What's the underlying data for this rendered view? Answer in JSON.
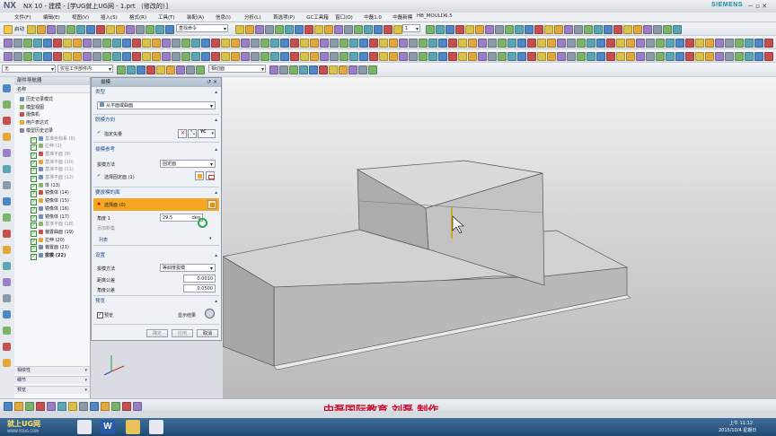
{
  "window": {
    "logo": "NX",
    "title": "NX 10 - 建模 - [学UG就上UG网 - 1.prt （修改的）]",
    "brand": "SIEMENS",
    "controls": "－ ▫ ✕"
  },
  "menubar": {
    "items": [
      "文件(F)",
      "编辑(E)",
      "视图(V)",
      "插入(S)",
      "格式(R)",
      "工具(T)",
      "装配(A)",
      "信息(I)",
      "分析(L)",
      "首选项(P)",
      "GC工具箱",
      "窗口(O)",
      "中磊1.0",
      "中磊新模",
      "HB_MOULD6.5"
    ]
  },
  "toolbar1": {
    "start_label": "启动",
    "command_finder_placeholder": "查找命令",
    "layer_value": "1"
  },
  "toolbar3": {
    "filter_value": "无",
    "scope_value": "仅在工作部件内",
    "snap_value": "相切面"
  },
  "navigator": {
    "title": "部件导航器",
    "column_name": "名称",
    "items": [
      {
        "label": "历史记录模式",
        "style": "normal"
      },
      {
        "label": "模型视图",
        "style": "normal"
      },
      {
        "label": "摄像机",
        "style": "normal"
      },
      {
        "label": "用户表达式",
        "style": "normal"
      },
      {
        "label": "模型历史记录",
        "style": "normal"
      },
      {
        "label": "基准坐标系 (0)",
        "style": "dim"
      },
      {
        "label": "拉伸 (1)",
        "style": "dim"
      },
      {
        "label": "基准平面 (9)",
        "style": "dim"
      },
      {
        "label": "基准平面 (10)",
        "style": "dim"
      },
      {
        "label": "基准平面 (11)",
        "style": "dim"
      },
      {
        "label": "基准平面 (12)",
        "style": "dim"
      },
      {
        "label": "体 (13)",
        "style": "normal"
      },
      {
        "label": "镜像体 (14)",
        "style": "normal"
      },
      {
        "label": "镜像体 (15)",
        "style": "normal"
      },
      {
        "label": "镜像体 (16)",
        "style": "normal"
      },
      {
        "label": "镜像体 (17)",
        "style": "normal"
      },
      {
        "label": "基准平面 (18)",
        "style": "dim"
      },
      {
        "label": "偏置曲面 (19)",
        "style": "normal"
      },
      {
        "label": "拉伸 (20)",
        "style": "normal"
      },
      {
        "label": "偏置面 (21)",
        "style": "normal"
      },
      {
        "label": "拔模 (22)",
        "style": "bold"
      }
    ],
    "sections": [
      "相依性",
      "细节",
      "预览"
    ]
  },
  "dialog": {
    "title": "拔模",
    "type_section": "类型",
    "type_value": "从平面或曲面",
    "direction_section": "脱模方向",
    "direction_label": "指定矢量",
    "vector_tag": "YC",
    "reference_section": "拔模参考",
    "draft_method_label": "拔模方法",
    "draft_method_value": "固定面",
    "select_fixed_face": "选择固定面 (1)",
    "faces_section": "要拔模的面",
    "select_face": "选择面 (0)",
    "angle_label": "角度 1",
    "angle_value": "29.5",
    "angle_unit": "deg",
    "add_set": "添加新集",
    "list_label": "列表",
    "settings_section": "设置",
    "settings_method_label": "拔模方法",
    "settings_method_value": "等斜度拔模",
    "distance_tol_label": "距离公差",
    "distance_tol_value": "0.0010",
    "angle_tol_label": "角度公差",
    "angle_tol_value": "0.0500",
    "preview_section": "预览",
    "preview_label": "预览",
    "show_result_label": "显示结果",
    "ok_label": "确定",
    "apply_label": "应用",
    "cancel_label": "取消"
  },
  "caption": "中磊国际教育  刘磊  制作",
  "taskbar": {
    "logo_text": "就上UG网",
    "logo_sub": "WWW.YOUG.COM",
    "time": "上午 11:12",
    "date": "2015/10/4 星期日"
  },
  "colors": {
    "accent_orange": "#f5a623",
    "section_blue": "#1f4e8a",
    "caption_red": "#c8102e",
    "model_gray": "#c3c3c3"
  }
}
